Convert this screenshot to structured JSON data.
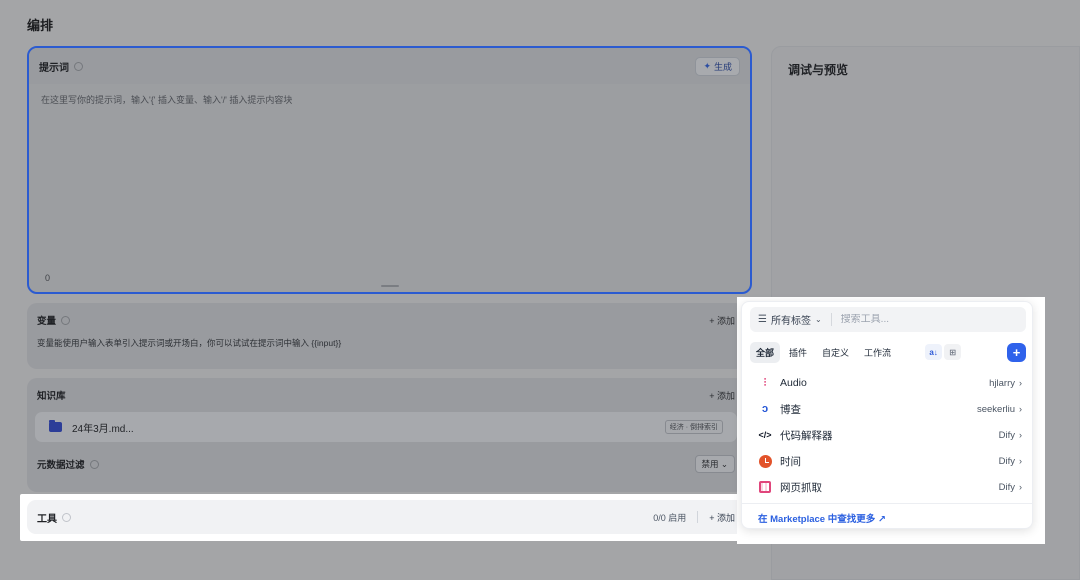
{
  "page": {
    "title": "编排"
  },
  "prompt": {
    "title": "提示词",
    "generate_label": "生成",
    "placeholder": "在这里写你的提示词，输入'{' 插入变量、输入'/' 插入提示内容块",
    "char_count": "0"
  },
  "variables": {
    "title": "变量",
    "add_label": "+ 添加",
    "description": "变量能使用户输入表单引入提示词或开场白，你可以试试在提示词中输入 {{input}}"
  },
  "knowledge": {
    "title": "知识库",
    "add_label": "+ 添加",
    "item_name": "24年3月.md...",
    "item_tag": "经济 · 倒排索引"
  },
  "metadata_filter": {
    "title": "元数据过滤",
    "select_value": "禁用 ⌄"
  },
  "tools": {
    "title": "工具",
    "status": "0/0 启用",
    "add_label": "+ 添加"
  },
  "preview": {
    "title": "调试与预览"
  },
  "tool_picker": {
    "tag_filter_label": "所有标签",
    "search_placeholder": "搜索工具...",
    "tabs": [
      {
        "label": "全部",
        "active": true
      },
      {
        "label": "插件",
        "active": false
      },
      {
        "label": "自定义",
        "active": false
      },
      {
        "label": "工作流",
        "active": false
      }
    ],
    "items": [
      {
        "name": "Audio",
        "author": "hjlarry",
        "icon": "audio-icon"
      },
      {
        "name": "博查",
        "author": "seekerliu",
        "icon": "bocha-icon"
      },
      {
        "name": "代码解释器",
        "author": "Dify",
        "icon": "code-icon"
      },
      {
        "name": "时间",
        "author": "Dify",
        "icon": "time-icon"
      },
      {
        "name": "网页抓取",
        "author": "Dify",
        "icon": "webscraper-icon"
      }
    ],
    "marketplace_link": "在 Marketplace 中查找更多 ↗"
  },
  "colors": {
    "accent": "#2f62eb",
    "overlay": "#a4a5a7"
  }
}
